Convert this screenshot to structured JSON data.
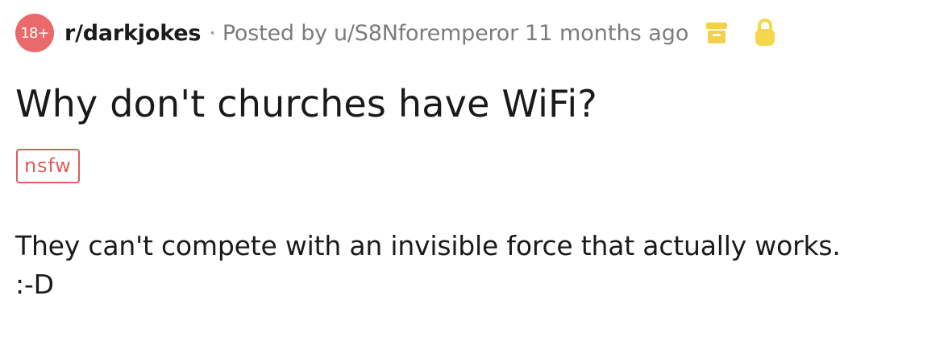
{
  "header": {
    "nsfw_badge": "18+",
    "subreddit": "r/darkjokes",
    "separator": "·",
    "posted_by_prefix": "Posted by",
    "author": "u/S8Nforemperor",
    "time_ago": "11 months ago",
    "icons": {
      "archive": "archive-icon",
      "lock": "lock-icon"
    },
    "colors": {
      "nsfw": "#ea6a6c",
      "archive_icon": "#f3d14c",
      "lock_icon": "#f5d74c",
      "meta_text": "#7c7c7c"
    }
  },
  "post": {
    "title": "Why don't churches have WiFi?",
    "flair": "nsfw",
    "body_lines": [
      "They can't compete with an invisible force that actually works.",
      ":-D"
    ]
  }
}
